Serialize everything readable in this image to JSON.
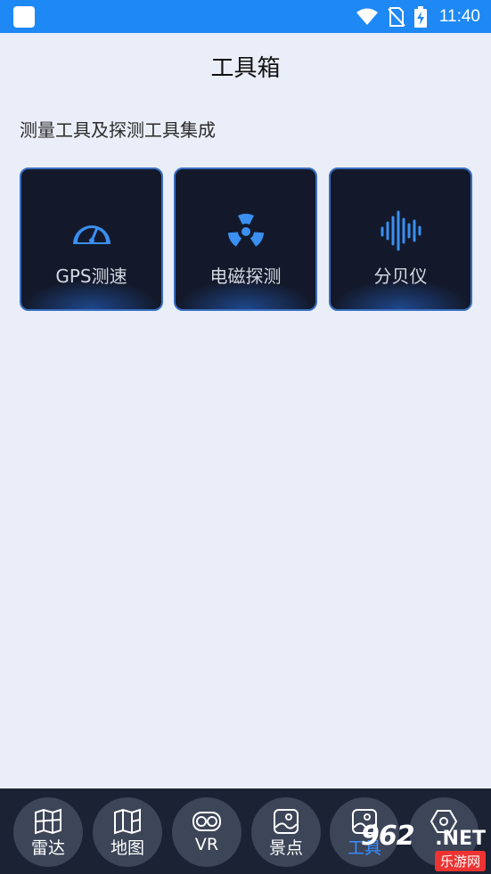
{
  "status_bar": {
    "time": "11:40"
  },
  "page": {
    "title": "工具箱",
    "subtitle": "测量工具及探测工具集成"
  },
  "tools": [
    {
      "label": "GPS测速",
      "icon": "speedometer-icon"
    },
    {
      "label": "电磁探测",
      "icon": "radiation-icon"
    },
    {
      "label": "分贝仪",
      "icon": "sound-wave-icon"
    }
  ],
  "bottom_nav": {
    "items": [
      {
        "label": "雷达",
        "icon": "map-icon"
      },
      {
        "label": "地图",
        "icon": "map-icon"
      },
      {
        "label": "VR",
        "icon": "vr-glasses-icon"
      },
      {
        "label": "景点",
        "icon": "image-icon"
      },
      {
        "label": "工具",
        "icon": "image-icon",
        "active": true
      },
      {
        "label": "",
        "icon": "settings-icon"
      }
    ]
  },
  "watermark": {
    "brand": "962",
    "suffix": ".NET",
    "caption": "乐游网"
  },
  "colors": {
    "accent": "#3a8dff",
    "status_bar": "#1e88f5",
    "card_bg": "#13192b",
    "nav_bg": "#1b2233"
  }
}
